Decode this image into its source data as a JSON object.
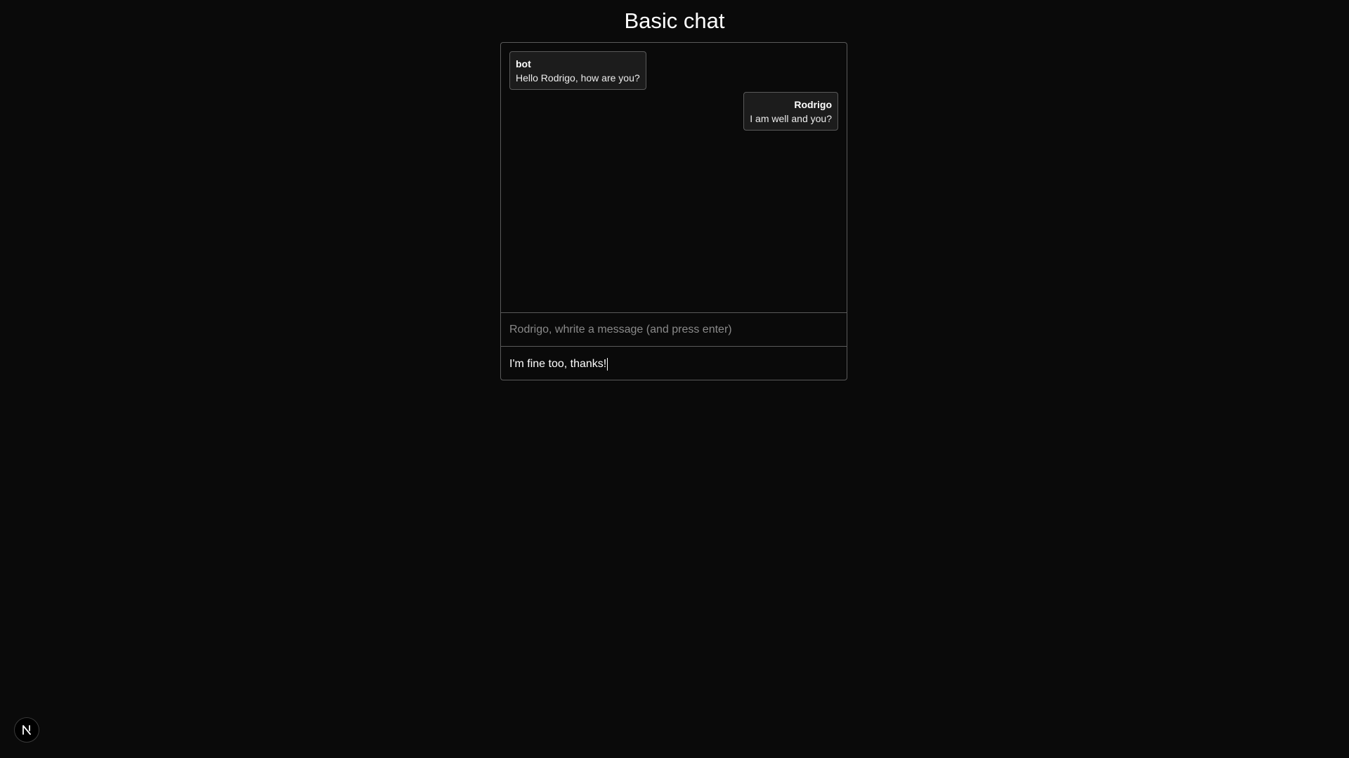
{
  "page": {
    "title": "Basic chat"
  },
  "messages": [
    {
      "author": "bot",
      "text": "Hello Rodrigo, how are you?"
    },
    {
      "author": "Rodrigo",
      "text": "I am well and you?"
    }
  ],
  "composer": {
    "placeholder": "Rodrigo, whrite a message (and press enter)",
    "value": "I'm fine too, thanks!"
  },
  "badge": {
    "icon": "nextjs-logo-icon",
    "letter": "N"
  },
  "colors": {
    "background": "#0a0a0a",
    "border": "#5a5a5a",
    "bubble": "#1c1c1c",
    "placeholder": "#8a8a8a"
  }
}
